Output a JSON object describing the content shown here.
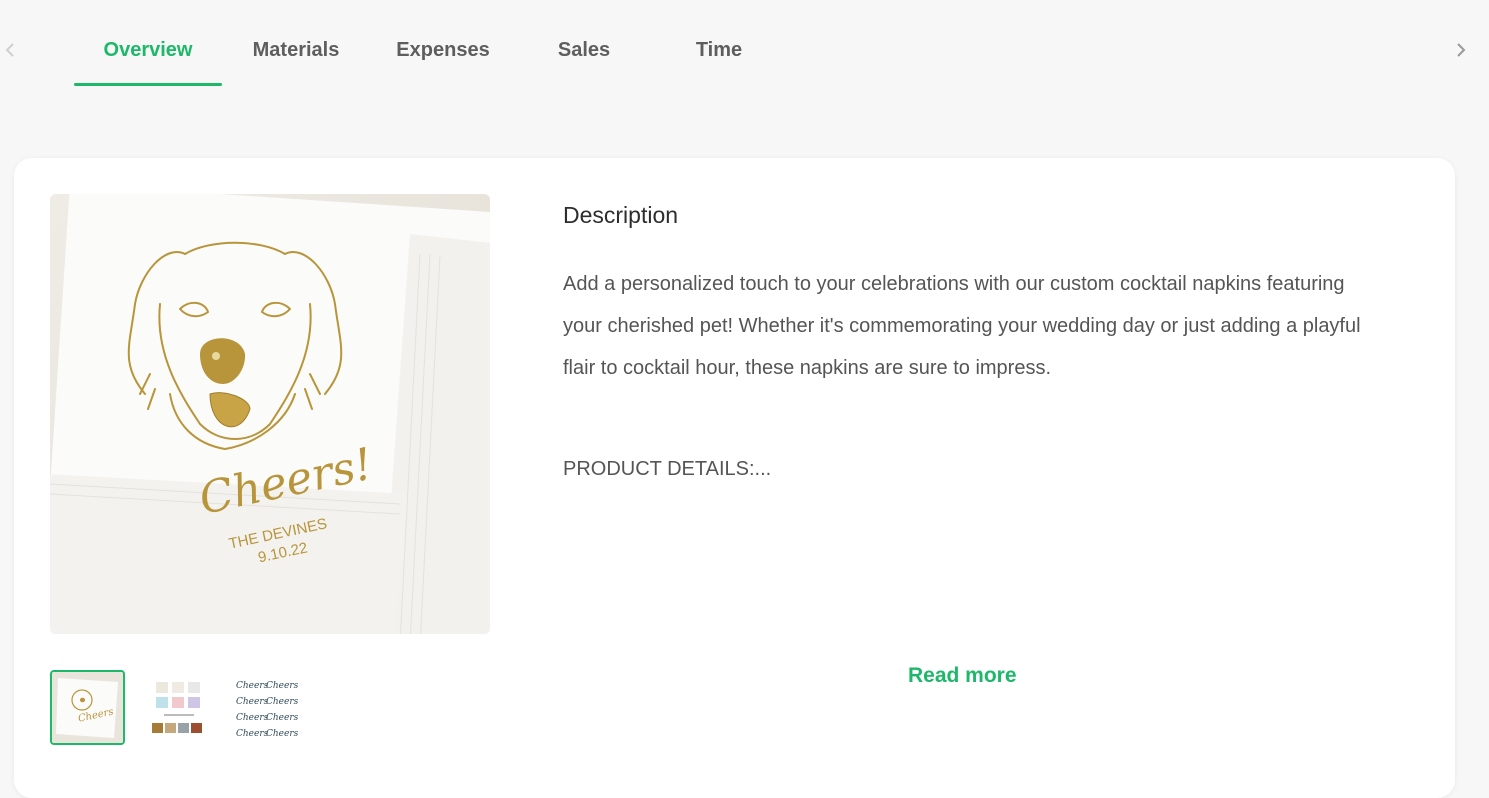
{
  "tabs": [
    {
      "label": "Overview",
      "active": true
    },
    {
      "label": "Materials",
      "active": false
    },
    {
      "label": "Expenses",
      "active": false
    },
    {
      "label": "Sales",
      "active": false
    },
    {
      "label": "Time",
      "active": false
    }
  ],
  "nav": {
    "prev_icon": "chevron-left-icon",
    "next_icon": "chevron-right-icon"
  },
  "product": {
    "image_text": {
      "cheers": "Cheers!",
      "names": "THE DEVINES",
      "date": "9.10.22"
    },
    "thumbnails": [
      "napkin-photo-thumbnail",
      "color-swatches-thumbnail",
      "design-options-thumbnail"
    ],
    "description_title": "Description",
    "description_text": "Add a personalized touch to your celebrations with our custom cocktail napkins featuring your cherished pet! Whether it's commemorating your wedding day or just adding a playful flair to cocktail hour, these napkins are sure to impress.",
    "details_text": "PRODUCT DETAILS:...",
    "read_more_label": "Read more"
  },
  "colors": {
    "accent": "#1db86a",
    "background": "#f7f7f7",
    "card": "#ffffff",
    "gold": "#b8953a"
  }
}
